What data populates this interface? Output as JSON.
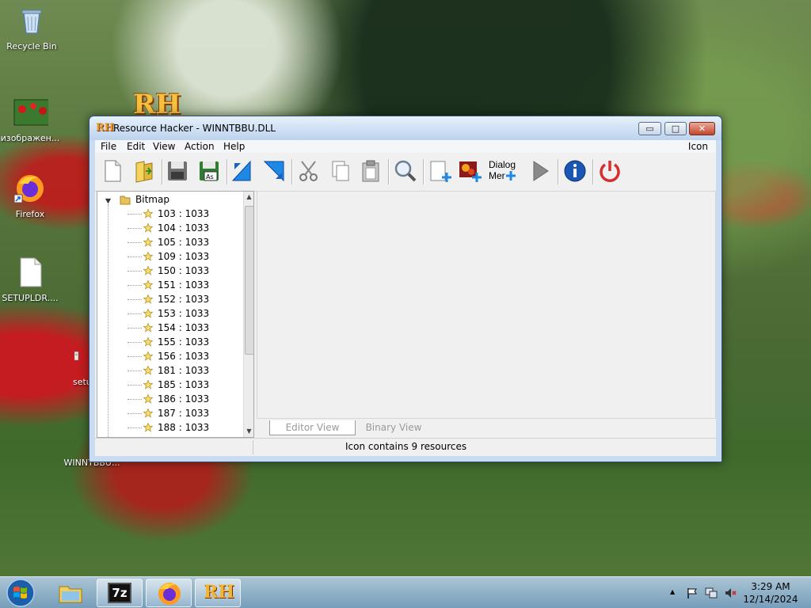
{
  "desktop": {
    "icons": [
      {
        "label": "Recycle Bin"
      },
      {
        "label": "изображен..."
      },
      {
        "label": "Firefox"
      },
      {
        "label": "SETUPLDR...."
      },
      {
        "label": "setu"
      },
      {
        "label": "WINNTBBU..."
      }
    ],
    "logo_text": "RH"
  },
  "window": {
    "title": "Resource Hacker - WINNTBBU.DLL",
    "logo": "RH",
    "controls": {
      "minimize": "▭",
      "maximize": "□",
      "close": "✕"
    },
    "menu": {
      "items": [
        "File",
        "Edit",
        "View",
        "Action",
        "Help"
      ],
      "right": "Icon"
    },
    "toolbar": {
      "buttons": [
        "new-file-icon",
        "open-file-icon",
        "save-icon",
        "save-as-icon",
        "back-arrow-icon",
        "forward-arrow-icon",
        "cut-icon",
        "copy-icon",
        "paste-icon",
        "search-icon",
        "add-resource-icon",
        "add-image-icon",
        "dialog-menu-icon",
        "play-icon",
        "info-icon",
        "power-icon"
      ],
      "dialog_label_line1": "Dialog",
      "dialog_label_line2": "Mer"
    },
    "tree": {
      "root": "Bitmap",
      "items": [
        "103 : 1033",
        "104 : 1033",
        "105 : 1033",
        "109 : 1033",
        "150 : 1033",
        "151 : 1033",
        "152 : 1033",
        "153 : 1033",
        "154 : 1033",
        "155 : 1033",
        "156 : 1033",
        "181 : 1033",
        "185 : 1033",
        "186 : 1033",
        "187 : 1033",
        "188 : 1033"
      ]
    },
    "tabs": {
      "editor": "Editor View",
      "binary": "Binary View"
    },
    "status": "Icon contains 9 resources"
  },
  "taskbar": {
    "apps": [
      "explorer",
      "7z",
      "firefox",
      "resource-hacker"
    ],
    "app_7z_label": "7z",
    "app_rh_label": "RH",
    "clock_time": "3:29 AM",
    "clock_date": "12/14/2024",
    "tray_arrow": "▲"
  },
  "colors": {
    "accent": "#1f6fbf",
    "title_bar": "#c9dcf2",
    "rh_orange": "#e89a20"
  }
}
